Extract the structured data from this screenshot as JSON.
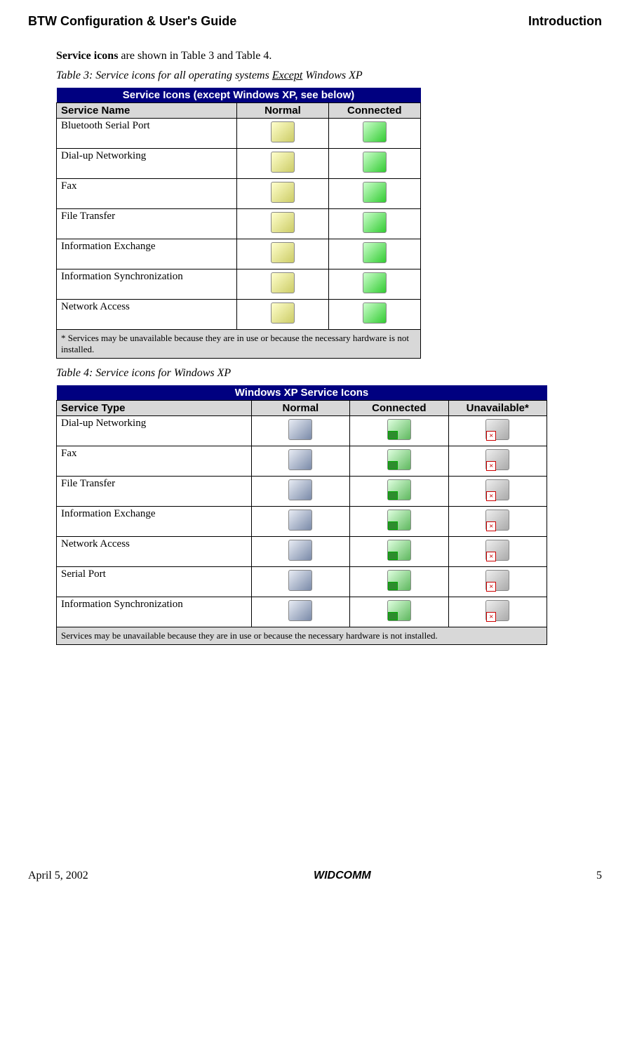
{
  "header": {
    "left": "BTW Configuration & User's Guide",
    "right": "Introduction"
  },
  "intro": {
    "bold": "Service icons",
    "rest": " are shown in Table 3 and Table 4."
  },
  "table3": {
    "caption_prefix": "Table 3:      Service icons for all operating systems ",
    "caption_underline": "Except",
    "caption_suffix": " Windows XP",
    "title": "Service Icons (except Windows XP, see below)",
    "cols": [
      "Service Name",
      "Normal",
      "Connected"
    ],
    "rows": [
      "Bluetooth Serial Port",
      "Dial-up Networking",
      "Fax",
      "File Transfer",
      "Information Exchange",
      "Information Synchronization",
      "Network Access"
    ],
    "footnote": "* Services may be unavailable because they are in use or because the necessary hardware is not installed."
  },
  "table4": {
    "caption": "Table 4:      Service icons for Windows XP",
    "title": "Windows XP Service Icons",
    "cols": [
      "Service Type",
      "Normal",
      "Connected",
      "Unavailable*"
    ],
    "rows": [
      "Dial-up Networking",
      "Fax",
      "File Transfer",
      "Information Exchange",
      "Network Access",
      "Serial Port",
      "Information Synchronization"
    ],
    "footnote": "Services may be unavailable because they are in use or because the necessary hardware is not installed."
  },
  "footer": {
    "left": "April 5, 2002",
    "center": "WIDCOMM",
    "right": "5"
  }
}
